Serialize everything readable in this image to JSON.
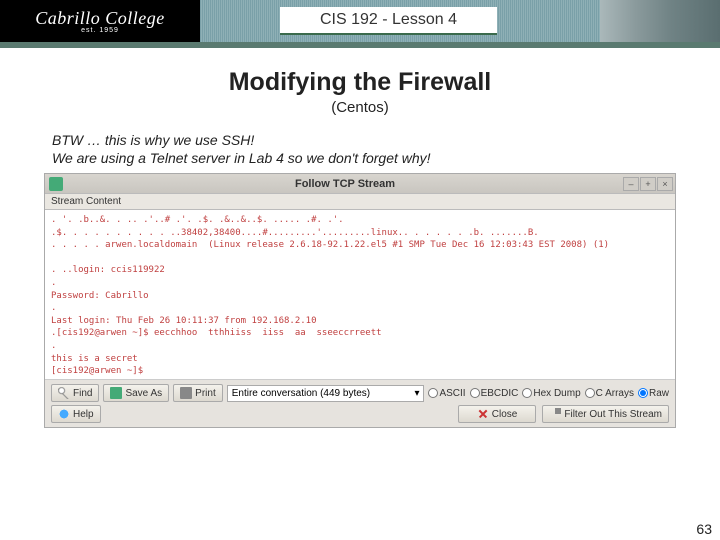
{
  "header": {
    "logo": "Cabrillo College",
    "logo_sub": "est. 1959",
    "lesson": "CIS 192 - Lesson 4"
  },
  "slide": {
    "title": "Modifying the Firewall",
    "subtitle": "(Centos)",
    "note_line1": "BTW … this is why we use SSH!",
    "note_line2": "We are using a Telnet server in Lab 4 so we don't forget why!"
  },
  "wireshark": {
    "window_title": "Follow TCP Stream",
    "content_label": "Stream Content",
    "stream_text": ". '. .b..&. . .. .'..# .'. .$. .&..&..$. ..... .#. .'.\n.$. . . . . . . . . . ..38402,38400....#.........'.........linux.. . . . . . .b. .......B.\n. . . . . arwen.localdomain  (Linux release 2.6.18-92.1.22.el5 #1 SMP Tue Dec 16 12:03:43 EST 2008) (1)\n\n. ..login: ccis119922\n.\nPassword: Cabrillo\n.\nLast login: Thu Feb 26 10:11:37 from 192.168.2.10\n.[cis192@arwen ~]$ eecchhoo  tthhiiss  iiss  aa  sseeccrreett\n.\nthis is a secret\n[cis192@arwen ~]$ ",
    "password": "Cabrillo",
    "buttons": {
      "find": "Find",
      "save_as": "Save As",
      "print": "Print",
      "help": "Help",
      "close": "Close",
      "filter": "Filter Out This Stream"
    },
    "dropdown_text": "Entire conversation (449 bytes)",
    "radios": {
      "ascii": "ASCII",
      "ebcdic": "EBCDIC",
      "hex": "Hex Dump",
      "carrays": "C Arrays",
      "raw": "Raw",
      "selected": "raw"
    }
  },
  "page_number": "63"
}
